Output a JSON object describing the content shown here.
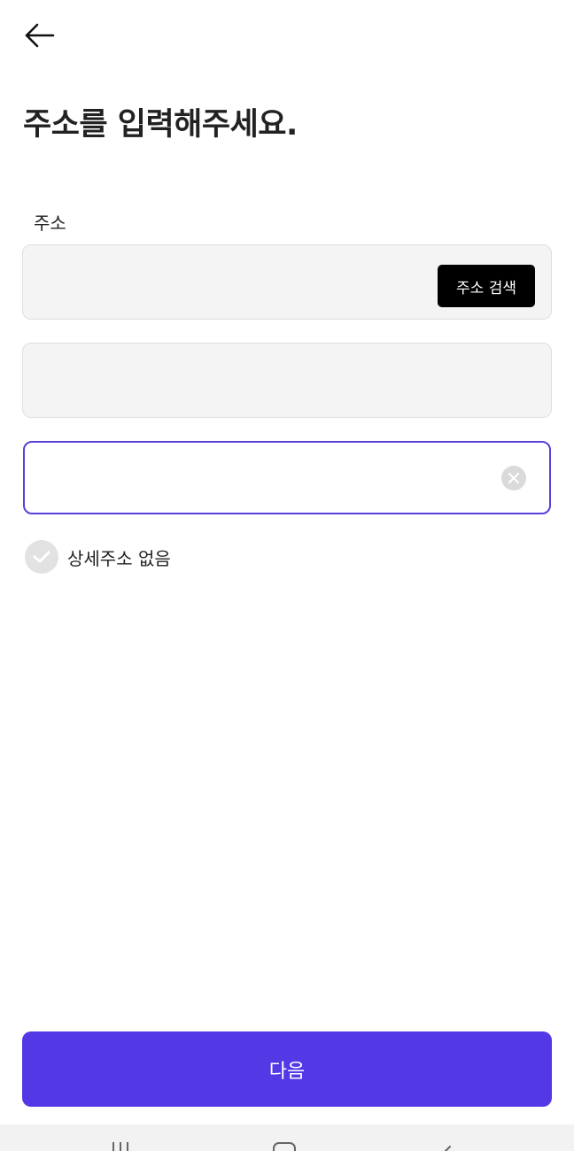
{
  "header": {
    "back_icon": "arrow-left-icon",
    "title": "주소를 입력해주세요."
  },
  "form": {
    "address_label": "주소",
    "address_value": "",
    "search_button_label": "주소 검색",
    "extra_address_value": "",
    "detail_address_value": "",
    "detail_address_placeholder": "",
    "clear_icon": "clear-circle-icon",
    "no_detail_checkbox": {
      "label": "상세주소 없음",
      "checked": false,
      "icon": "check-icon"
    }
  },
  "footer": {
    "next_button_label": "다음"
  },
  "system_nav": {
    "items": [
      "recent-apps-icon",
      "home-icon",
      "back-icon"
    ]
  },
  "colors": {
    "accent": "#5239e5",
    "focus_border": "#5b3fd9",
    "field_bg": "#f4f4f4",
    "search_button_bg": "#000000"
  }
}
